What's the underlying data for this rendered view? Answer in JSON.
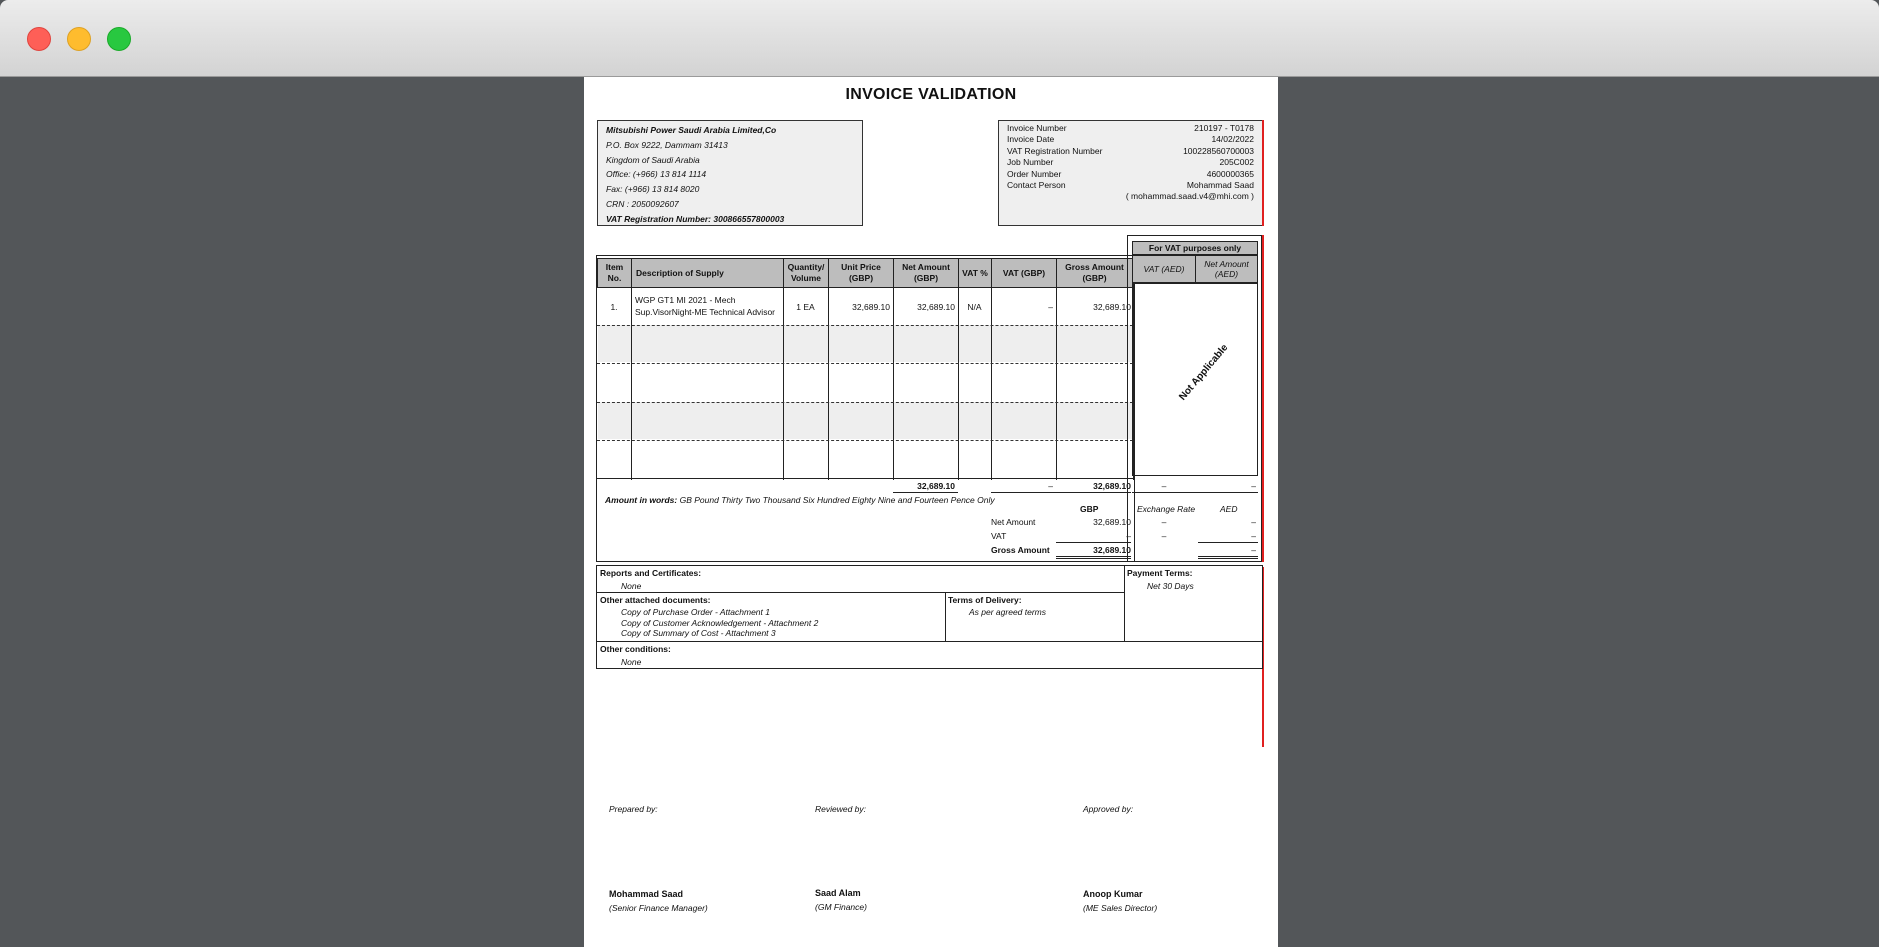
{
  "window": {
    "title": ""
  },
  "doc": {
    "title": "INVOICE VALIDATION",
    "supplier": {
      "name": "Mitsubishi Power Saudi Arabia Limited,Co",
      "po_box": "P.O. Box 9222, Dammam 31413",
      "country": "Kingdom of Saudi Arabia",
      "office": "Office: (+966) 13 814 1114",
      "fax": "Fax: (+966) 13 814 8020",
      "crn": "CRN : 2050092607",
      "vat_reg": "VAT Registration Number: 300866557800003"
    },
    "invoice_info": {
      "rows": [
        {
          "label": "Invoice Number",
          "value": "210197 - T0178"
        },
        {
          "label": "Invoice Date",
          "value": "14/02/2022"
        },
        {
          "label": "VAT Registration Number",
          "value": "100228560700003"
        },
        {
          "label": "Job Number",
          "value": "205C002"
        },
        {
          "label": "Order Number",
          "value": "4600000365"
        },
        {
          "label": "Contact Person",
          "value": "Mohammad Saad"
        }
      ],
      "email": "( mohammad.saad.v4@mhi.com )"
    },
    "table": {
      "headers": {
        "item_no": "Item No.",
        "description": "Description of Supply",
        "quantity": "Quantity/ Volume",
        "unit_price": "Unit Price (GBP)",
        "net_amount": "Net Amount (GBP)",
        "vat_pct": "VAT %",
        "vat_gbp": "VAT (GBP)",
        "gross": "Gross Amount (GBP)"
      },
      "rows": [
        {
          "item_no": "1.",
          "description_line1": "WGP GT1 MI 2021 - Mech",
          "description_line2": "Sup.VisorNight-ME Technical Advisor",
          "quantity": "1 EA",
          "unit_price": "32,689.10",
          "net_amount": "32,689.10",
          "vat_pct": "N/A",
          "vat_gbp": "–",
          "gross": "32,689.10"
        }
      ],
      "totals": {
        "net_amount": "32,689.10",
        "vat_gbp": "–",
        "gross": "32,689.10"
      }
    },
    "vat_panel": {
      "title": "For VAT purposes only",
      "col_vat_aed": "VAT (AED)",
      "col_net_aed": "Net Amount (AED)",
      "not_applicable": "Not Applicable",
      "totals": {
        "vat_aed": "–",
        "net_aed": "–"
      },
      "exchange_rate_label": "Exchange Rate",
      "aed_label": "AED",
      "net_aed_value": "–",
      "net_rate_value": "–",
      "vat_aed_value": "–",
      "vat_rate_value": "–",
      "gross_aed_value": "–"
    },
    "amount_words": {
      "label": "Amount in words:",
      "text": "GB Pound Thirty Two Thousand Six Hundred Eighty Nine and Fourteen Pence Only"
    },
    "summary": {
      "currency": "GBP",
      "net_label": "Net Amount",
      "net_value": "32,689.10",
      "vat_label": "VAT",
      "vat_value": "–",
      "gross_label": "Gross Amount",
      "gross_value": "32,689.10"
    },
    "sections": {
      "reports_label": "Reports and Certificates:",
      "reports_value": "None",
      "payment_label": "Payment Terms:",
      "payment_value": "Net 30 Days",
      "attached_label": "Other attached documents:",
      "attached_items": [
        "Copy of Purchase Order - Attachment 1",
        "Copy of Customer Acknowledgement - Attachment 2",
        "Copy of Summary of Cost - Attachment 3"
      ],
      "delivery_label": "Terms of Delivery:",
      "delivery_value": "As per agreed terms",
      "conditions_label": "Other conditions:",
      "conditions_value": "None"
    },
    "signatures": [
      {
        "label": "Prepared by:",
        "name": "Mohammad Saad",
        "role": "(Senior Finance Manager)"
      },
      {
        "label": "Reviewed by:",
        "name": "Saad Alam",
        "role": "(GM Finance)"
      },
      {
        "label": "Approved by:",
        "name": "Anoop Kumar",
        "role": "(ME Sales Director)"
      }
    ]
  },
  "colors": {
    "desktop": "#535659",
    "header_fill": "#bdbdbd",
    "box_fill": "#efefef",
    "accent_red": "#e02020"
  }
}
